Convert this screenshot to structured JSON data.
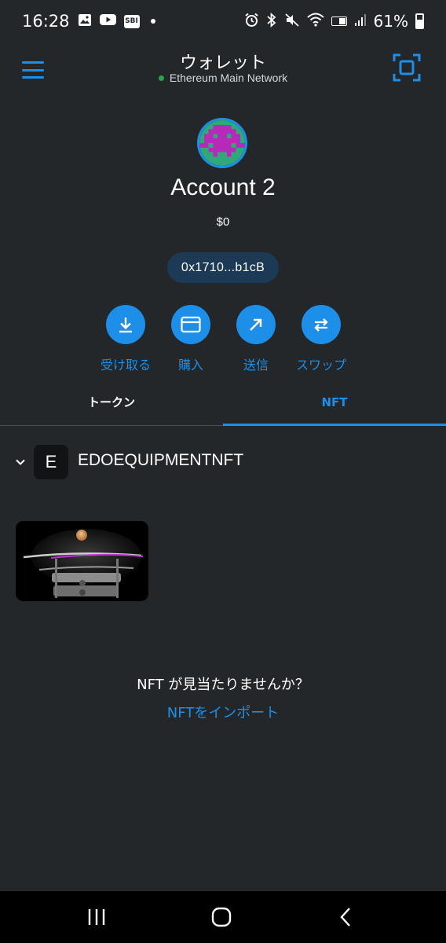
{
  "status_bar": {
    "time": "16:28",
    "notification_icons": [
      "photo-icon",
      "youtube-icon",
      "sbi-icon"
    ],
    "sbi_label": "SBI",
    "battery": "61%",
    "battery_level": 0.61
  },
  "header": {
    "title": "ウォレット",
    "network": "Ethereum Main Network"
  },
  "account": {
    "name": "Account 2",
    "balance": "$0",
    "address": "0x1710...b1cB"
  },
  "actions": [
    {
      "label": "受け取る",
      "icon": "receive-icon"
    },
    {
      "label": "購入",
      "icon": "card-icon"
    },
    {
      "label": "送信",
      "icon": "send-arrow-icon"
    },
    {
      "label": "スワップ",
      "icon": "swap-icon"
    }
  ],
  "tabs": [
    {
      "label": "トークン",
      "active": false
    },
    {
      "label": "NFT",
      "active": true
    }
  ],
  "collection": {
    "badge": "E",
    "name": "EDOEQUIPMENTNFT"
  },
  "empty_state": {
    "text": "NFT が見当たりませんか？",
    "link": "NFTをインポート"
  },
  "colors": {
    "background": "#24272a",
    "accent": "#1d8fe8",
    "network_dot": "#28a745"
  }
}
